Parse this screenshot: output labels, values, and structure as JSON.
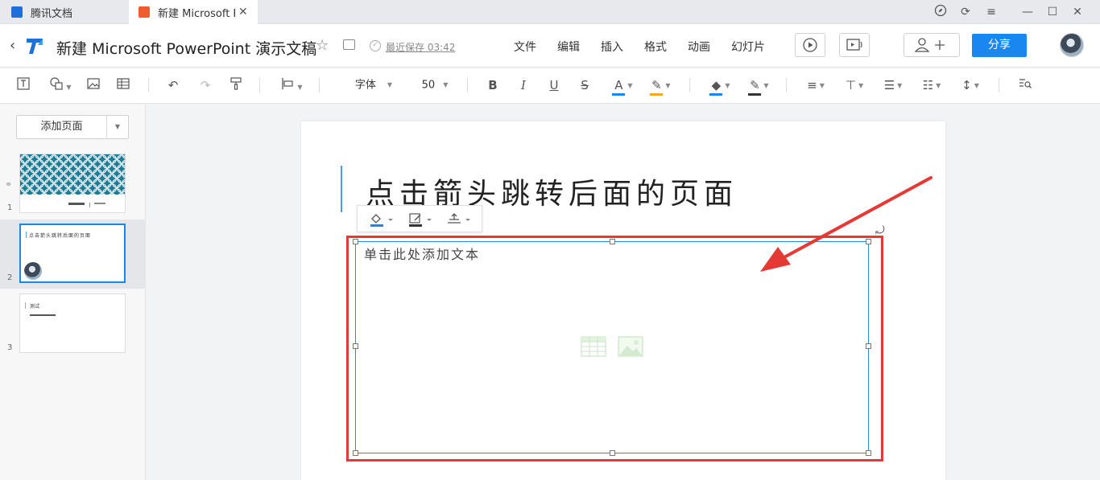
{
  "tabs": [
    {
      "label": "腾讯文档",
      "active": false
    },
    {
      "label": "新建 Microsoft P",
      "active": true
    }
  ],
  "header": {
    "title": "新建 Microsoft PowerPoint 演示文稿",
    "saved_status": "最近保存 03:42",
    "menus": [
      "文件",
      "编辑",
      "插入",
      "格式",
      "动画",
      "幻灯片"
    ],
    "share_label": "分享"
  },
  "toolbar": {
    "font": "字体",
    "font_size": "50",
    "text_color": "#1a87f0",
    "highlight_color": "#f5a623",
    "fill_color": "#1a87f0",
    "line_color": "#333333"
  },
  "sidebar": {
    "add_page_label": "添加页面",
    "slides": [
      {
        "number": "1",
        "title": ""
      },
      {
        "number": "2",
        "title": "点击箭头跳转后面的页面",
        "selected": true
      },
      {
        "number": "3",
        "title": "测试"
      }
    ]
  },
  "slide": {
    "title": "点击箭头跳转后面的页面",
    "content_placeholder": "单击此处添加文本"
  },
  "colors": {
    "accent": "#1a87f0",
    "annotation_red": "#e53935",
    "selection_blue": "#2a8ad6"
  }
}
